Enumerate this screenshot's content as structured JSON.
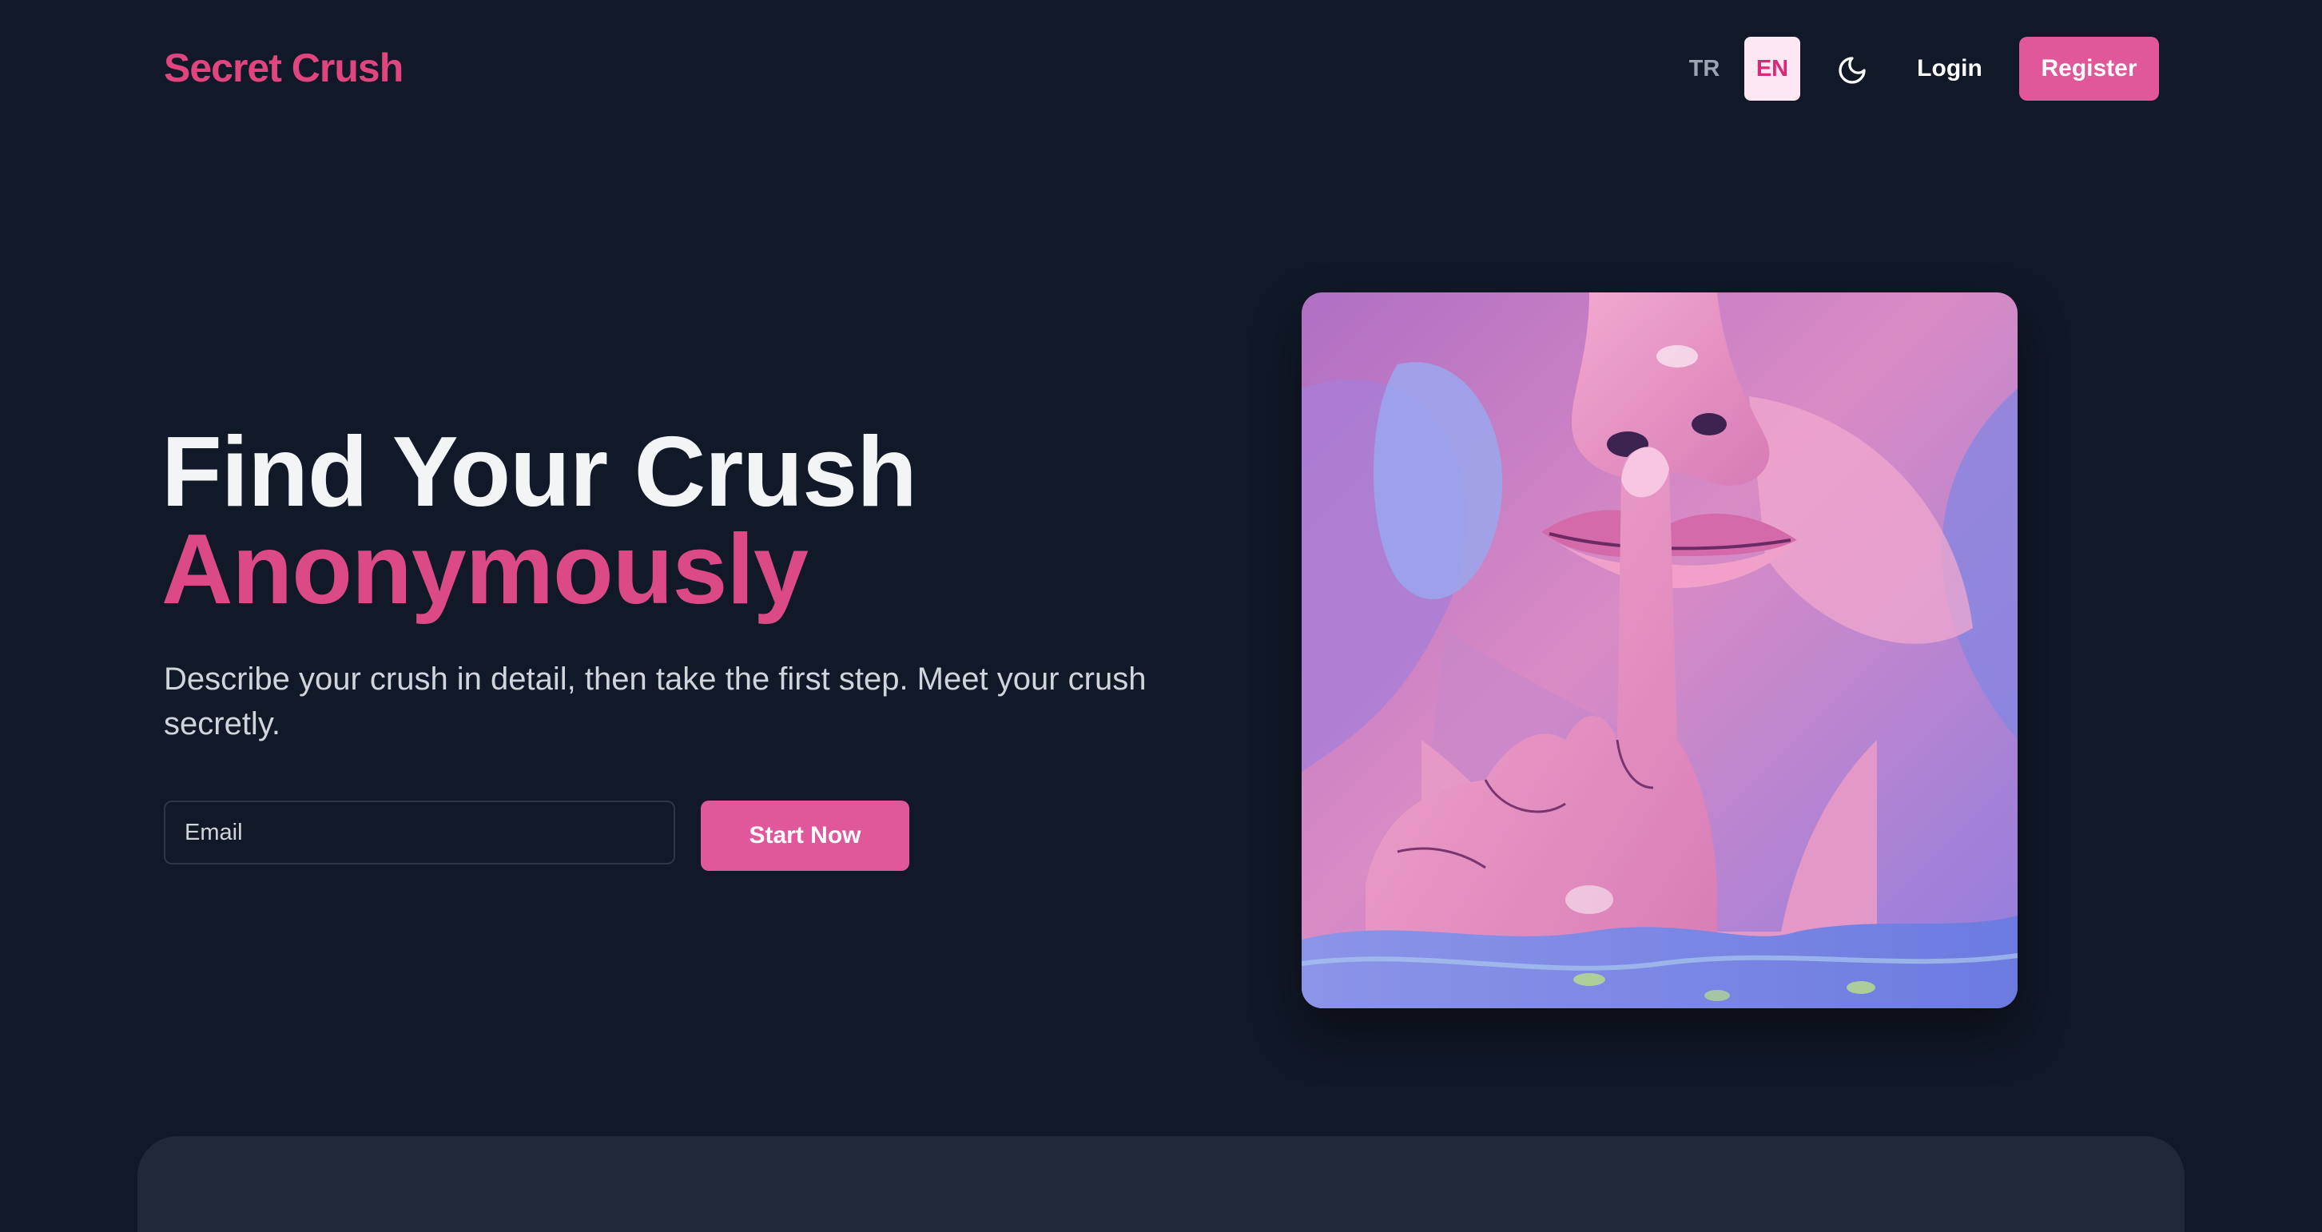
{
  "header": {
    "logo": "Secret Crush",
    "lang_tr": "TR",
    "lang_en": "EN",
    "active_lang": "EN",
    "theme_icon": "moon-icon",
    "login_label": "Login",
    "register_label": "Register"
  },
  "hero": {
    "title_line1": "Find Your Crush",
    "title_line2": "Anonymously",
    "subtitle": "Describe your crush in detail, then take the first step. Meet your crush secretly.",
    "email_placeholder": "Email",
    "email_value": "",
    "cta_label": "Start Now"
  },
  "colors": {
    "background": "#111827",
    "accent": "#e0579a",
    "accent_text": "#db4a87",
    "card": "#1f2937"
  }
}
